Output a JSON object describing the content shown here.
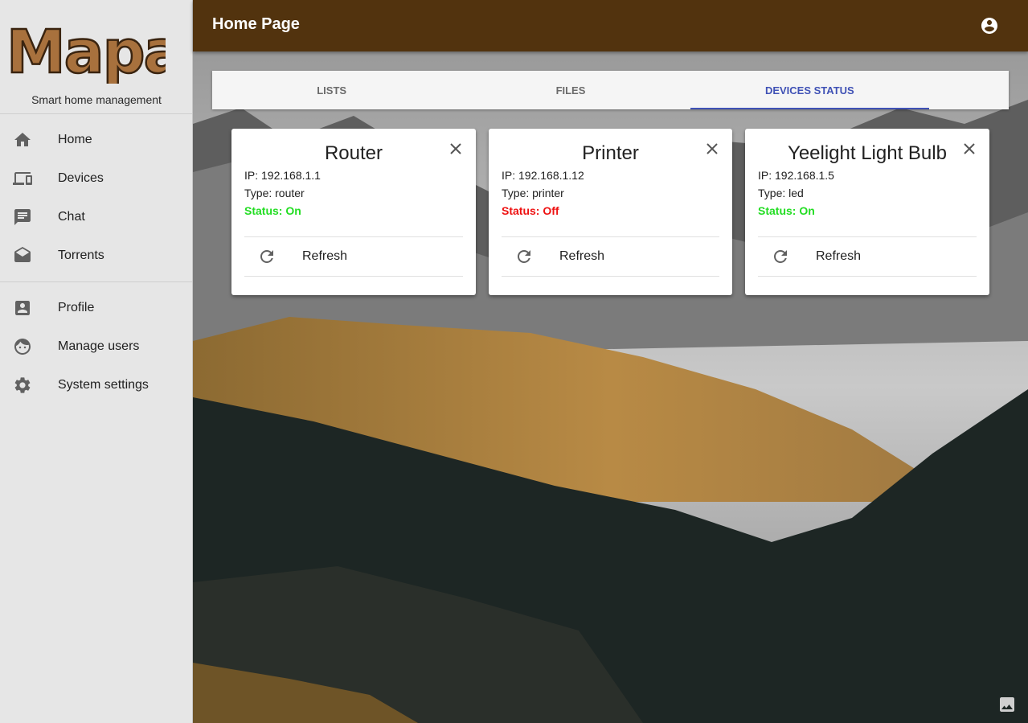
{
  "sidebar": {
    "logo_text": "Mapa",
    "tagline": "Smart home management",
    "primary_items": [
      {
        "label": "Home",
        "icon": "home-icon"
      },
      {
        "label": "Devices",
        "icon": "devices-icon"
      },
      {
        "label": "Chat",
        "icon": "chat-icon"
      },
      {
        "label": "Torrents",
        "icon": "drafts-icon"
      }
    ],
    "secondary_items": [
      {
        "label": "Profile",
        "icon": "account-box-icon"
      },
      {
        "label": "Manage users",
        "icon": "face-icon"
      },
      {
        "label": "System settings",
        "icon": "gear-icon"
      }
    ]
  },
  "header": {
    "title": "Home Page",
    "account_icon": "account-circle-icon"
  },
  "tabs": [
    {
      "label": "LISTS",
      "active": false
    },
    {
      "label": "FILES",
      "active": false
    },
    {
      "label": "DEVICES STATUS",
      "active": true
    }
  ],
  "devices": [
    {
      "name": "Router",
      "ip": "IP: 192.168.1.1",
      "type": "Type: router",
      "status": "Status: On",
      "status_on": true,
      "action": "Refresh"
    },
    {
      "name": "Printer",
      "ip": "IP: 192.168.1.12",
      "type": "Type: printer",
      "status": "Status: Off",
      "status_on": false,
      "action": "Refresh"
    },
    {
      "name": "Yeelight Light Bulb",
      "ip": "IP: 192.168.1.5",
      "type": "Type: led",
      "status": "Status: On",
      "status_on": true,
      "action": "Refresh"
    }
  ],
  "colors": {
    "appbar": "#52330e",
    "accent": "#3f51b5",
    "status_on": "#22dd22",
    "status_off": "#ee1111"
  }
}
